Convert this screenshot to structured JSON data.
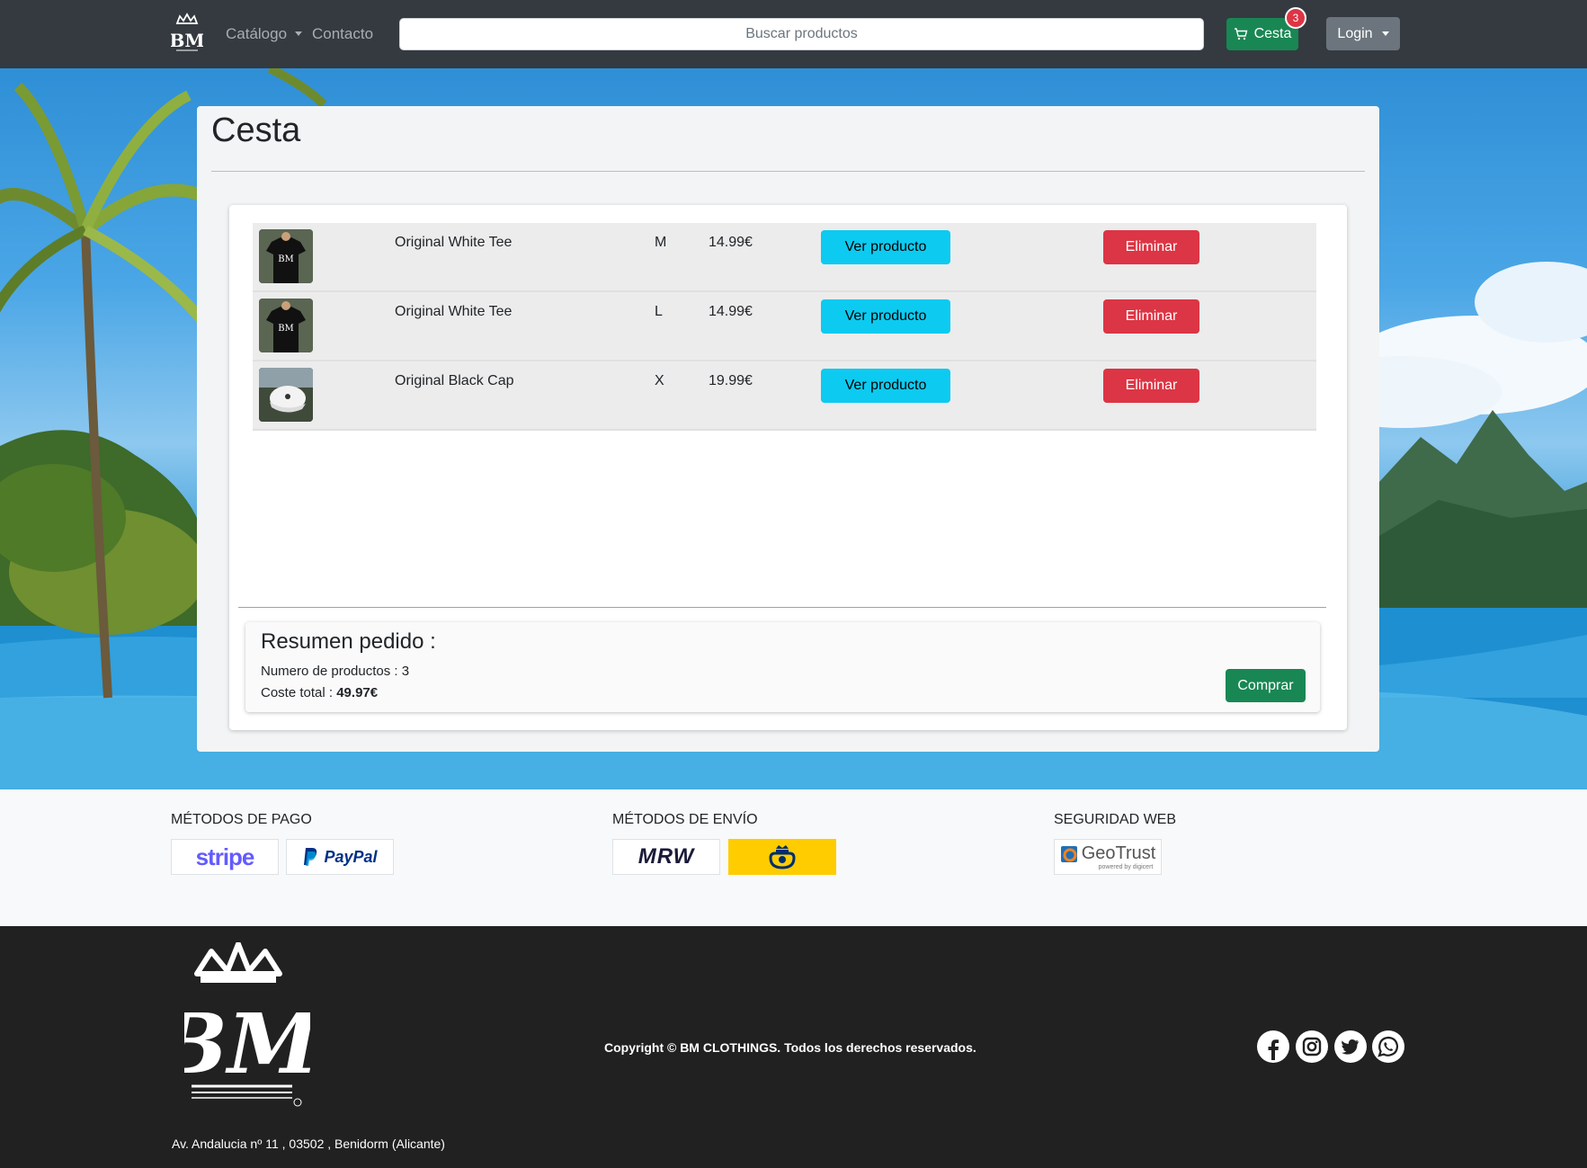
{
  "navbar": {
    "logo_icon": "bm-crown-logo",
    "catalogo": "Catálogo",
    "contacto": "Contacto",
    "search_placeholder": "Buscar productos",
    "cart_label": "Cesta",
    "cart_count": "3",
    "login": "Login",
    "colors": {
      "bg": "#343a40",
      "cart": "#198754",
      "badge": "#dc3545",
      "login": "#6c757d"
    }
  },
  "cart": {
    "title": "Cesta",
    "items": [
      {
        "name": "Original White Tee",
        "size": "M",
        "price": "14.99€",
        "view": "Ver producto",
        "remove": "Eliminar",
        "image": "tshirt-thumbnail"
      },
      {
        "name": "Original White Tee",
        "size": "L",
        "price": "14.99€",
        "view": "Ver producto",
        "remove": "Eliminar",
        "image": "tshirt-thumbnail"
      },
      {
        "name": "Original Black Cap",
        "size": "X",
        "price": "19.99€",
        "view": "Ver producto",
        "remove": "Eliminar",
        "image": "cap-thumbnail"
      }
    ],
    "summary": {
      "title": "Resumen pedido :",
      "count_label": "Numero de productos : 3",
      "total_label": "Coste total : ",
      "total_value": "49.97€",
      "buy": "Comprar"
    },
    "colors": {
      "view": "#0dcaf0",
      "remove": "#dc3545",
      "buy": "#198754"
    }
  },
  "info": {
    "payment_title": "MÉTODOS DE PAGO",
    "payment_logos": [
      "stripe",
      "PayPal"
    ],
    "shipping_title": "MÉTODOS DE ENVÍO",
    "shipping_logos": [
      "MRW",
      "correos-icon"
    ],
    "security_title": "SEGURIDAD WEB",
    "security_logo": "GeoTrust",
    "security_sub": "powered by digicert"
  },
  "footer": {
    "logo_icon": "bm-crown-logo",
    "copyright": "Copyright © BM CLOTHINGS. Todos los derechos reservados.",
    "address": "Av. Andalucia nº 11 , 03502 , Benidorm (Alicante)",
    "social": [
      "facebook-icon",
      "instagram-icon",
      "twitter-icon",
      "whatsapp-icon"
    ]
  }
}
